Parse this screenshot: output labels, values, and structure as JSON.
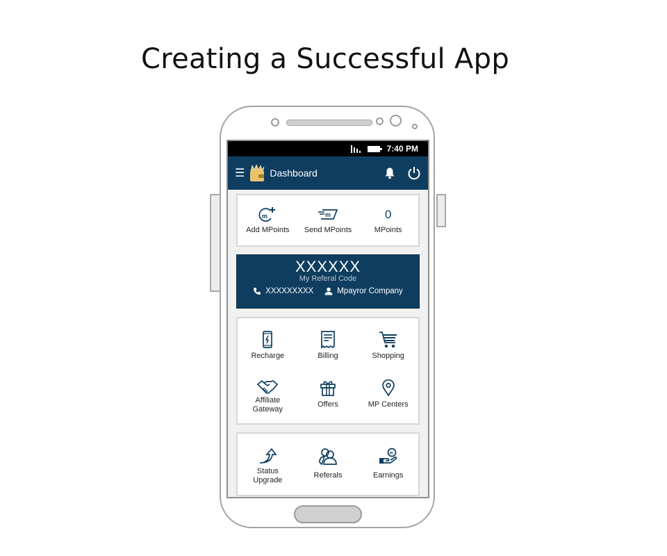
{
  "page": {
    "title": "Creating a Successful App"
  },
  "status_bar": {
    "time": "7:40 PM",
    "signal_icon": "signal-icon",
    "battery_icon": "battery-icon"
  },
  "app_bar": {
    "title": "Dashboard",
    "menu_icon": "hamburger-menu-icon",
    "logo_icon": "wallet-crown-logo",
    "notification_icon": "bell-icon",
    "power_icon": "power-icon"
  },
  "mpoints": {
    "add_label": "Add MPoints",
    "send_label": "Send MPoints",
    "balance_value": "0",
    "balance_label": "MPoints"
  },
  "referral": {
    "code": "XXXXXX",
    "label": "My Referal Code",
    "phone": "XXXXXXXXX",
    "company": "Mpayror Company"
  },
  "services": [
    {
      "label": "Recharge",
      "icon": "mobile-recharge-icon"
    },
    {
      "label": "Billing",
      "icon": "bill-icon"
    },
    {
      "label": "Shopping",
      "icon": "shopping-cart-icon"
    },
    {
      "label_line1": "Affiliate",
      "label_line2": "Gateway",
      "icon": "handshake-icon"
    },
    {
      "label": "Offers",
      "icon": "gift-icon"
    },
    {
      "label": "MP Centers",
      "icon": "location-pin-icon"
    }
  ],
  "account": [
    {
      "label_line1": "Status",
      "label_line2": "Upgrade",
      "icon": "upgrade-arrow-icon"
    },
    {
      "label": "Referals",
      "icon": "referrals-people-icon"
    },
    {
      "label": "Earnings",
      "icon": "earnings-hand-coin-icon"
    }
  ],
  "colors": {
    "primary": "#0f3d5f",
    "status_bar": "#000000",
    "logo_gold": "#e8c36a"
  }
}
